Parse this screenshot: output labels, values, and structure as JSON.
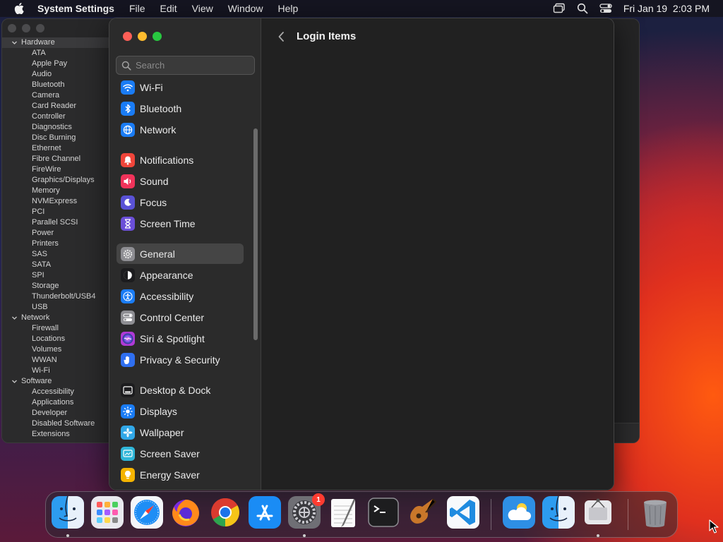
{
  "menubar": {
    "app_name": "System Settings",
    "menus": [
      "File",
      "Edit",
      "View",
      "Window",
      "Help"
    ],
    "clock": "Fri Jan 19  2:03 PM"
  },
  "background_window": {
    "tree": [
      {
        "group": "Hardware",
        "items": [
          "ATA",
          "Apple Pay",
          "Audio",
          "Bluetooth",
          "Camera",
          "Card Reader",
          "Controller",
          "Diagnostics",
          "Disc Burning",
          "Ethernet",
          "Fibre Channel",
          "FireWire",
          "Graphics/Displays",
          "Memory",
          "NVMExpress",
          "PCI",
          "Parallel SCSI",
          "Power",
          "Printers",
          "SAS",
          "SATA",
          "SPI",
          "Storage",
          "Thunderbolt/USB4",
          "USB"
        ]
      },
      {
        "group": "Network",
        "items": [
          "Firewall",
          "Locations",
          "Volumes",
          "WWAN",
          "Wi-Fi"
        ]
      },
      {
        "group": "Software",
        "items": [
          "Accessibility",
          "Applications",
          "Developer",
          "Disabled Software",
          "Extensions"
        ]
      }
    ]
  },
  "settings": {
    "search_placeholder": "Search",
    "sidebar": [
      {
        "label": "Wi-Fi",
        "icon": "wifi-icon",
        "color": "#1a7cf5"
      },
      {
        "label": "Bluetooth",
        "icon": "bluetooth-icon",
        "color": "#1a7cf5"
      },
      {
        "label": "Network",
        "icon": "globe-icon",
        "color": "#1a7cf5"
      },
      {
        "label": "Notifications",
        "icon": "bell-icon",
        "color": "#f0453a"
      },
      {
        "label": "Sound",
        "icon": "speaker-icon",
        "color": "#f0335a"
      },
      {
        "label": "Focus",
        "icon": "moon-icon",
        "color": "#5a52d6"
      },
      {
        "label": "Screen Time",
        "icon": "hourglass-icon",
        "color": "#6b4fd8"
      },
      {
        "label": "General",
        "icon": "gear-icon",
        "color": "#8e8e93"
      },
      {
        "label": "Appearance",
        "icon": "appearance-icon",
        "color": "#1c1c1e"
      },
      {
        "label": "Accessibility",
        "icon": "accessibility-icon",
        "color": "#1a7cf5"
      },
      {
        "label": "Control Center",
        "icon": "control-center-icon",
        "color": "#8e8e93"
      },
      {
        "label": "Siri & Spotlight",
        "icon": "siri-icon",
        "color": "#b03ad6"
      },
      {
        "label": "Privacy & Security",
        "icon": "hand-icon",
        "color": "#2f6ff0"
      },
      {
        "label": "Desktop & Dock",
        "icon": "dock-icon",
        "color": "#1c1c1e"
      },
      {
        "label": "Displays",
        "icon": "sun-icon",
        "color": "#1a7cf5"
      },
      {
        "label": "Wallpaper",
        "icon": "wallpaper-icon",
        "color": "#31a8e8"
      },
      {
        "label": "Screen Saver",
        "icon": "screensaver-icon",
        "color": "#2fb6d8"
      },
      {
        "label": "Energy Saver",
        "icon": "bulb-icon",
        "color": "#f5b400"
      }
    ],
    "selected": "General",
    "page_title": "Login Items"
  },
  "dock": {
    "apps": [
      {
        "name": "Finder",
        "icon": "finder-icon"
      },
      {
        "name": "Launchpad",
        "icon": "launchpad-icon"
      },
      {
        "name": "Safari",
        "icon": "safari-icon"
      },
      {
        "name": "Firefox",
        "icon": "firefox-icon"
      },
      {
        "name": "Chrome",
        "icon": "chrome-icon"
      },
      {
        "name": "App Store",
        "icon": "app-store-icon"
      },
      {
        "name": "System Settings",
        "icon": "system-settings-icon",
        "badge": "1"
      },
      {
        "name": "TextEdit",
        "icon": "textedit-icon"
      },
      {
        "name": "Terminal",
        "icon": "terminal-icon"
      },
      {
        "name": "GarageBand",
        "icon": "guitar-icon"
      },
      {
        "name": "VS Code",
        "icon": "vscode-icon"
      },
      {
        "name": "Weather",
        "icon": "weather-icon"
      },
      {
        "name": "Finder",
        "icon": "finder-icon"
      },
      {
        "name": "System Information",
        "icon": "system-info-icon"
      },
      {
        "name": "Trash",
        "icon": "trash-icon"
      }
    ]
  }
}
